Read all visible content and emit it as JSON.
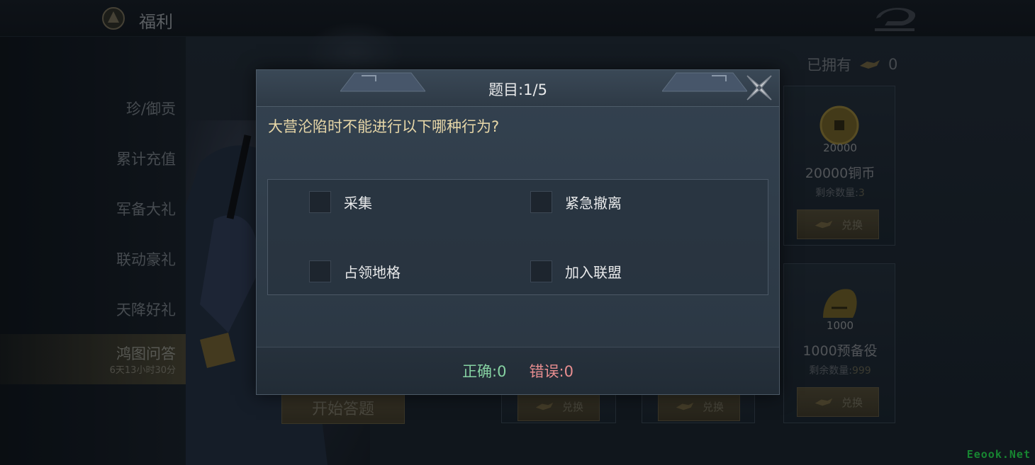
{
  "topbar": {
    "title": "福利"
  },
  "sidebar": {
    "items": [
      {
        "label": "珍/御贡"
      },
      {
        "label": "累计充值"
      },
      {
        "label": "军备大礼"
      },
      {
        "label": "联动豪礼"
      },
      {
        "label": "天降好礼"
      },
      {
        "label": "鸿图问答",
        "sub": "6天13小时30分",
        "active": true
      }
    ]
  },
  "shop": {
    "owned_label": "已拥有",
    "owned_count": "0",
    "cards": [
      {
        "qty": "20000",
        "name": "20000铜币",
        "remaining_label": "剩余数量:",
        "remaining": "3",
        "redeem": "兑换"
      },
      {
        "qty": "1000",
        "name": "1000预备役",
        "remaining_label": "剩余数量:",
        "remaining": "999",
        "redeem": "兑换"
      }
    ],
    "bottom_cards": [
      {
        "redeem": "兑换"
      },
      {
        "redeem": "兑换"
      }
    ]
  },
  "start_button": "开始答题",
  "quiz": {
    "title": "题目:1/5",
    "question": "大营沦陷时不能进行以下哪种行为?",
    "options": [
      "采集",
      "紧急撤离",
      "占领地格",
      "加入联盟"
    ],
    "correct": "正确:0",
    "wrong": "错误:0"
  },
  "watermark": "Eeook.Net",
  "icons": {
    "close": "close-x-icon",
    "back": "dragon-back-icon",
    "coin": "copper-coin-icon",
    "helmet": "helmet-icon",
    "token": "token-icon"
  },
  "colors": {
    "question_text": "#e7d7a8",
    "correct": "#86d2a2",
    "wrong": "#e88e90",
    "gold_button": "#4c4530"
  }
}
